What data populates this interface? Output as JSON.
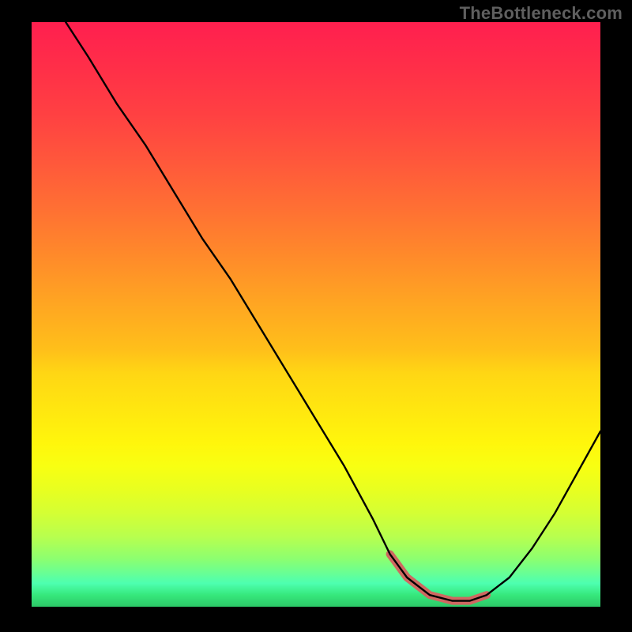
{
  "watermark": "TheBottleneck.com",
  "chart_data": {
    "type": "line",
    "title": "",
    "xlabel": "",
    "ylabel": "",
    "xlim": [
      0,
      100
    ],
    "ylim": [
      0,
      100
    ],
    "grid": false,
    "legend": false,
    "background_gradient": {
      "top": "#ff1f4f",
      "bottom": "#2cc867",
      "description": "red-to-green vertical gradient"
    },
    "series": [
      {
        "name": "bottleneck-curve",
        "color": "#000000",
        "x": [
          6,
          10,
          15,
          20,
          25,
          30,
          35,
          40,
          45,
          50,
          55,
          60,
          63,
          66,
          70,
          74,
          77,
          80,
          84,
          88,
          92,
          96,
          100
        ],
        "y": [
          100,
          94,
          86,
          79,
          71,
          63,
          56,
          48,
          40,
          32,
          24,
          15,
          9,
          5,
          2,
          1,
          1,
          2,
          5,
          10,
          16,
          23,
          30
        ]
      },
      {
        "name": "optimal-range-highlight",
        "color": "#cf6861",
        "x": [
          63,
          66,
          70,
          74,
          77,
          80
        ],
        "y": [
          9,
          5,
          2,
          1,
          1,
          2
        ]
      }
    ],
    "annotations": []
  }
}
